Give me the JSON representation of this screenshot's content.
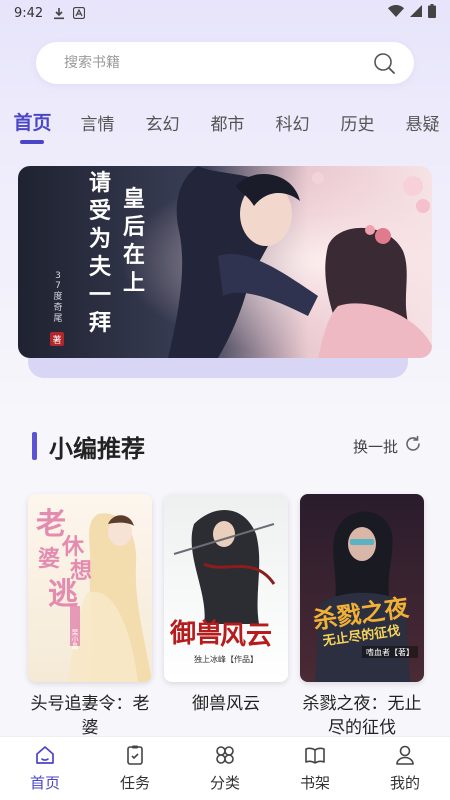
{
  "status_bar": {
    "time": "9:42"
  },
  "search": {
    "placeholder": "搜索书籍"
  },
  "tabs": [
    {
      "label": "首页",
      "active": true
    },
    {
      "label": "言情"
    },
    {
      "label": "玄幻"
    },
    {
      "label": "都市"
    },
    {
      "label": "科幻"
    },
    {
      "label": "历史"
    },
    {
      "label": "悬疑"
    }
  ],
  "banner": {
    "cover_lines": [
      "请受为夫一拜",
      "皇后在上"
    ],
    "author": "37度奇尾",
    "seal": "著"
  },
  "section": {
    "title": "小编推荐",
    "refresh_label": "换一批"
  },
  "books": [
    {
      "title": "头号追妻令：老婆",
      "cover_text": "老婆休想逃",
      "cover_author": "吴小晶"
    },
    {
      "title": "御兽风云",
      "cover_text": "御兽风云",
      "cover_author": "独上冰峰【作品】"
    },
    {
      "title": "杀戮之夜：无止尽的征伐",
      "cover_text": "杀戮之夜",
      "cover_sub": "无止尽的征伐",
      "cover_author": "嗜血者【著】"
    }
  ],
  "bottom_nav": [
    {
      "label": "首页",
      "icon": "home-icon",
      "active": true
    },
    {
      "label": "任务",
      "icon": "task-icon"
    },
    {
      "label": "分类",
      "icon": "category-icon"
    },
    {
      "label": "书架",
      "icon": "bookshelf-icon"
    },
    {
      "label": "我的",
      "icon": "profile-icon"
    }
  ],
  "colors": {
    "accent": "#4b45c7",
    "bg": "#f7f6fb"
  }
}
